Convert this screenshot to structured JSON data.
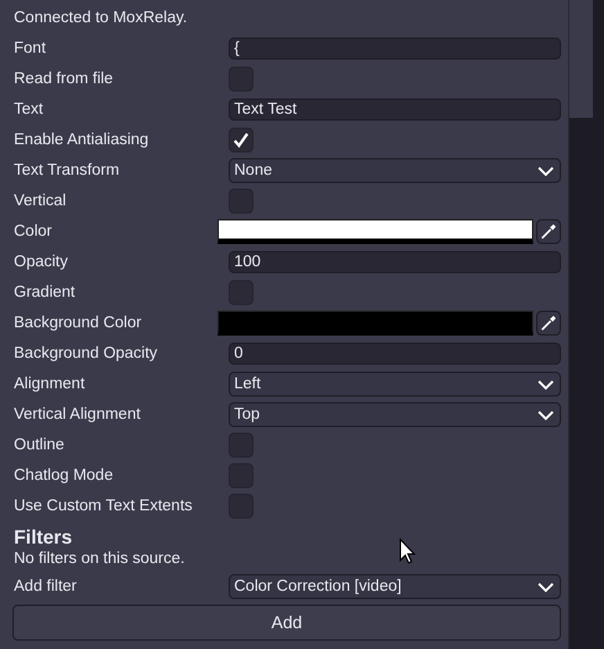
{
  "status": "Connected to MoxRelay.",
  "properties": [
    {
      "label": "Font",
      "kind": "text",
      "value": "{"
    },
    {
      "label": "Read from file",
      "kind": "checkbox",
      "checked": false
    },
    {
      "label": "Text",
      "kind": "text",
      "value": "Text Test"
    },
    {
      "label": "Enable Antialiasing",
      "kind": "checkbox",
      "checked": true
    },
    {
      "label": "Text Transform",
      "kind": "select",
      "value": "None"
    },
    {
      "label": "Vertical",
      "kind": "checkbox",
      "checked": false
    },
    {
      "label": "Color",
      "kind": "color",
      "color": "#ffffff"
    },
    {
      "label": "Opacity",
      "kind": "text",
      "value": "100"
    },
    {
      "label": "Gradient",
      "kind": "checkbox",
      "checked": false
    },
    {
      "label": "Background Color",
      "kind": "color",
      "color": "#000000"
    },
    {
      "label": "Background Opacity",
      "kind": "text",
      "value": "0"
    },
    {
      "label": "Alignment",
      "kind": "select",
      "value": "Left"
    },
    {
      "label": "Vertical Alignment",
      "kind": "select",
      "value": "Top"
    },
    {
      "label": "Outline",
      "kind": "checkbox",
      "checked": false
    },
    {
      "label": "Chatlog Mode",
      "kind": "checkbox",
      "checked": false
    },
    {
      "label": "Use Custom Text Extents",
      "kind": "checkbox",
      "checked": false
    }
  ],
  "filters": {
    "title": "Filters",
    "empty_message": "No filters on this source.",
    "add_label": "Add filter",
    "add_value": "Color Correction [video]",
    "add_button": "Add"
  }
}
